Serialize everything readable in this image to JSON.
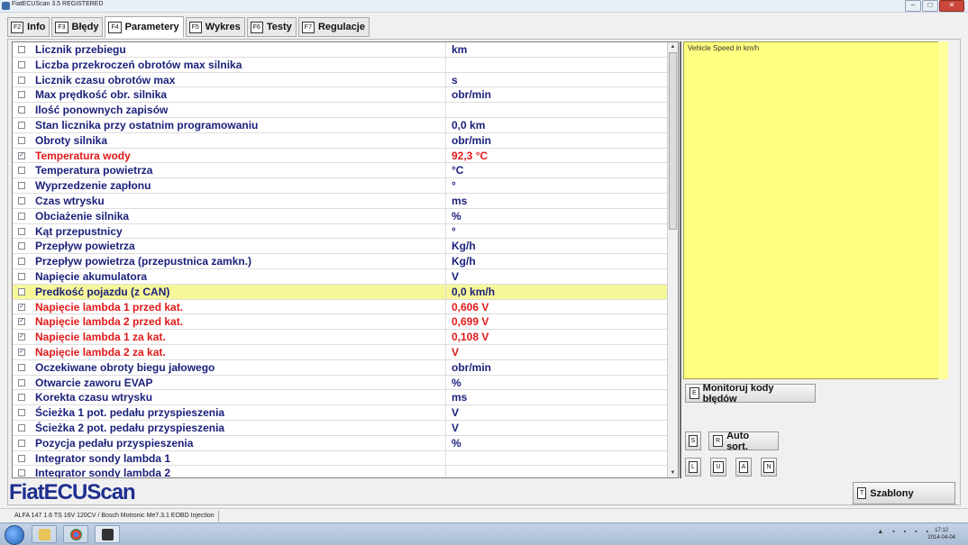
{
  "window": {
    "title": "FiatECUScan 3.5 REGISTERED"
  },
  "tabs": [
    {
      "key": "F2",
      "label": "Info"
    },
    {
      "key": "F3",
      "label": "Błędy"
    },
    {
      "key": "F4",
      "label": "Parametery"
    },
    {
      "key": "F5",
      "label": "Wykres"
    },
    {
      "key": "F6",
      "label": "Testy"
    },
    {
      "key": "F7",
      "label": "Regulacje"
    }
  ],
  "params": [
    {
      "checked": false,
      "name": "Licznik przebiegu",
      "value": "km"
    },
    {
      "checked": false,
      "name": "Liczba przekroczeń obrotów max silnika",
      "value": ""
    },
    {
      "checked": false,
      "name": "Licznik czasu obrotów max",
      "value": "s"
    },
    {
      "checked": false,
      "name": "Max prędkość obr. silnika",
      "value": "obr/min"
    },
    {
      "checked": false,
      "name": "Ilość ponownych zapisów",
      "value": ""
    },
    {
      "checked": false,
      "name": "Stan licznika przy ostatnim programowaniu",
      "value": "0,0 km"
    },
    {
      "checked": false,
      "name": "Obroty silnika",
      "value": "obr/min"
    },
    {
      "checked": true,
      "name": "Temperatura wody",
      "value": "92,3 °C"
    },
    {
      "checked": false,
      "name": "Temperatura powietrza",
      "value": "°C"
    },
    {
      "checked": false,
      "name": "Wyprzedzenie zapłonu",
      "value": "°"
    },
    {
      "checked": false,
      "name": "Czas wtrysku",
      "value": "ms"
    },
    {
      "checked": false,
      "name": "Obciażenie silnika",
      "value": "%"
    },
    {
      "checked": false,
      "name": "Kąt przepustnicy",
      "value": "°"
    },
    {
      "checked": false,
      "name": "Przepływ powietrza",
      "value": "Kg/h"
    },
    {
      "checked": false,
      "name": "Przepływ powietrza (przepustnica zamkn.)",
      "value": "Kg/h"
    },
    {
      "checked": false,
      "name": "Napięcie akumulatora",
      "value": "V"
    },
    {
      "checked": false,
      "name": "Predkość pojazdu (z CAN)",
      "value": "0,0 km/h",
      "highlight": true
    },
    {
      "checked": true,
      "name": "Napięcie lambda 1 przed kat.",
      "value": "0,606 V"
    },
    {
      "checked": true,
      "name": "Napięcie lambda 2 przed kat.",
      "value": "0,699 V"
    },
    {
      "checked": true,
      "name": "Napięcie lambda 1 za kat.",
      "value": "0,108 V"
    },
    {
      "checked": true,
      "name": "Napięcie lambda 2 za kat.",
      "value": "V"
    },
    {
      "checked": false,
      "name": "Oczekiwane obroty biegu jałowego",
      "value": "obr/min"
    },
    {
      "checked": false,
      "name": "Otwarcie zaworu EVAP",
      "value": "%"
    },
    {
      "checked": false,
      "name": "Korekta czasu wtrysku",
      "value": "ms"
    },
    {
      "checked": false,
      "name": "Ścieżka 1 pot. pedału przyspieszenia",
      "value": "V"
    },
    {
      "checked": false,
      "name": "Ścieżka 2 pot. pedału przyspieszenia",
      "value": "V"
    },
    {
      "checked": false,
      "name": "Pozycja pedału przyspieszenia",
      "value": "%"
    },
    {
      "checked": false,
      "name": "Integrator sondy lambda 1",
      "value": ""
    },
    {
      "checked": false,
      "name": "Integrator sondy lambda 2",
      "value": ""
    }
  ],
  "graph": {
    "title": "Vehicle Speed in km/h"
  },
  "buttons": {
    "monitor": {
      "key": "E",
      "label": "Monitoruj kody błędów"
    },
    "s": {
      "key": "S"
    },
    "autosort": {
      "key": "R",
      "label": "Auto sort."
    },
    "l": {
      "key": "L"
    },
    "u": {
      "key": "U"
    },
    "a": {
      "key": "A"
    },
    "n": {
      "key": "N"
    },
    "templates": {
      "key": "T",
      "label": "Szablony"
    }
  },
  "logo": "FiatECUScan",
  "status": {
    "ecu": "ALFA 147 1.6 TS 16V 120CV / Bosch Motronic Me7.3.1 EOBD Injection"
  },
  "clock": {
    "time": "17:12",
    "date": "2014-04-04"
  },
  "colors": {
    "param_text": "#1a1f7a",
    "active_text": "#e01a1a",
    "highlight_row": "#f7f79a",
    "graph_bg": "#ffff80"
  }
}
